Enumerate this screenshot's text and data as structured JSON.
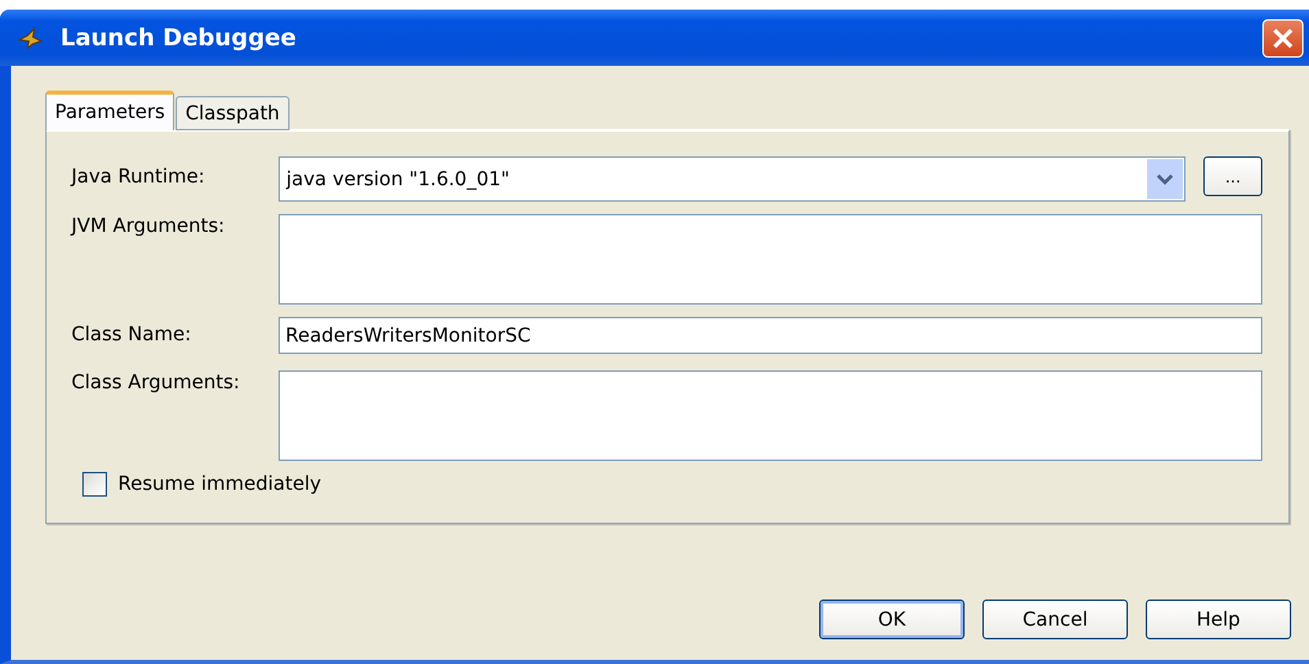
{
  "window": {
    "title": "Launch Debuggee"
  },
  "tabs": [
    {
      "label": "Parameters",
      "selected": true
    },
    {
      "label": "Classpath",
      "selected": false
    }
  ],
  "form": {
    "java_runtime": {
      "label": "Java Runtime:",
      "value": "java version \"1.6.0_01\"",
      "browse_button": "..."
    },
    "jvm_arguments": {
      "label": "JVM Arguments:"
    },
    "class_name": {
      "label": "Class Name:",
      "value": "ReadersWritersMonitorSC"
    },
    "class_arguments": {
      "label": "Class Arguments:"
    },
    "resume_immediately": {
      "label": "Resume immediately",
      "checked": false
    }
  },
  "buttons": [
    {
      "label": "OK",
      "default": true
    },
    {
      "label": "Cancel",
      "default": false
    },
    {
      "label": "Help",
      "default": false
    }
  ]
}
